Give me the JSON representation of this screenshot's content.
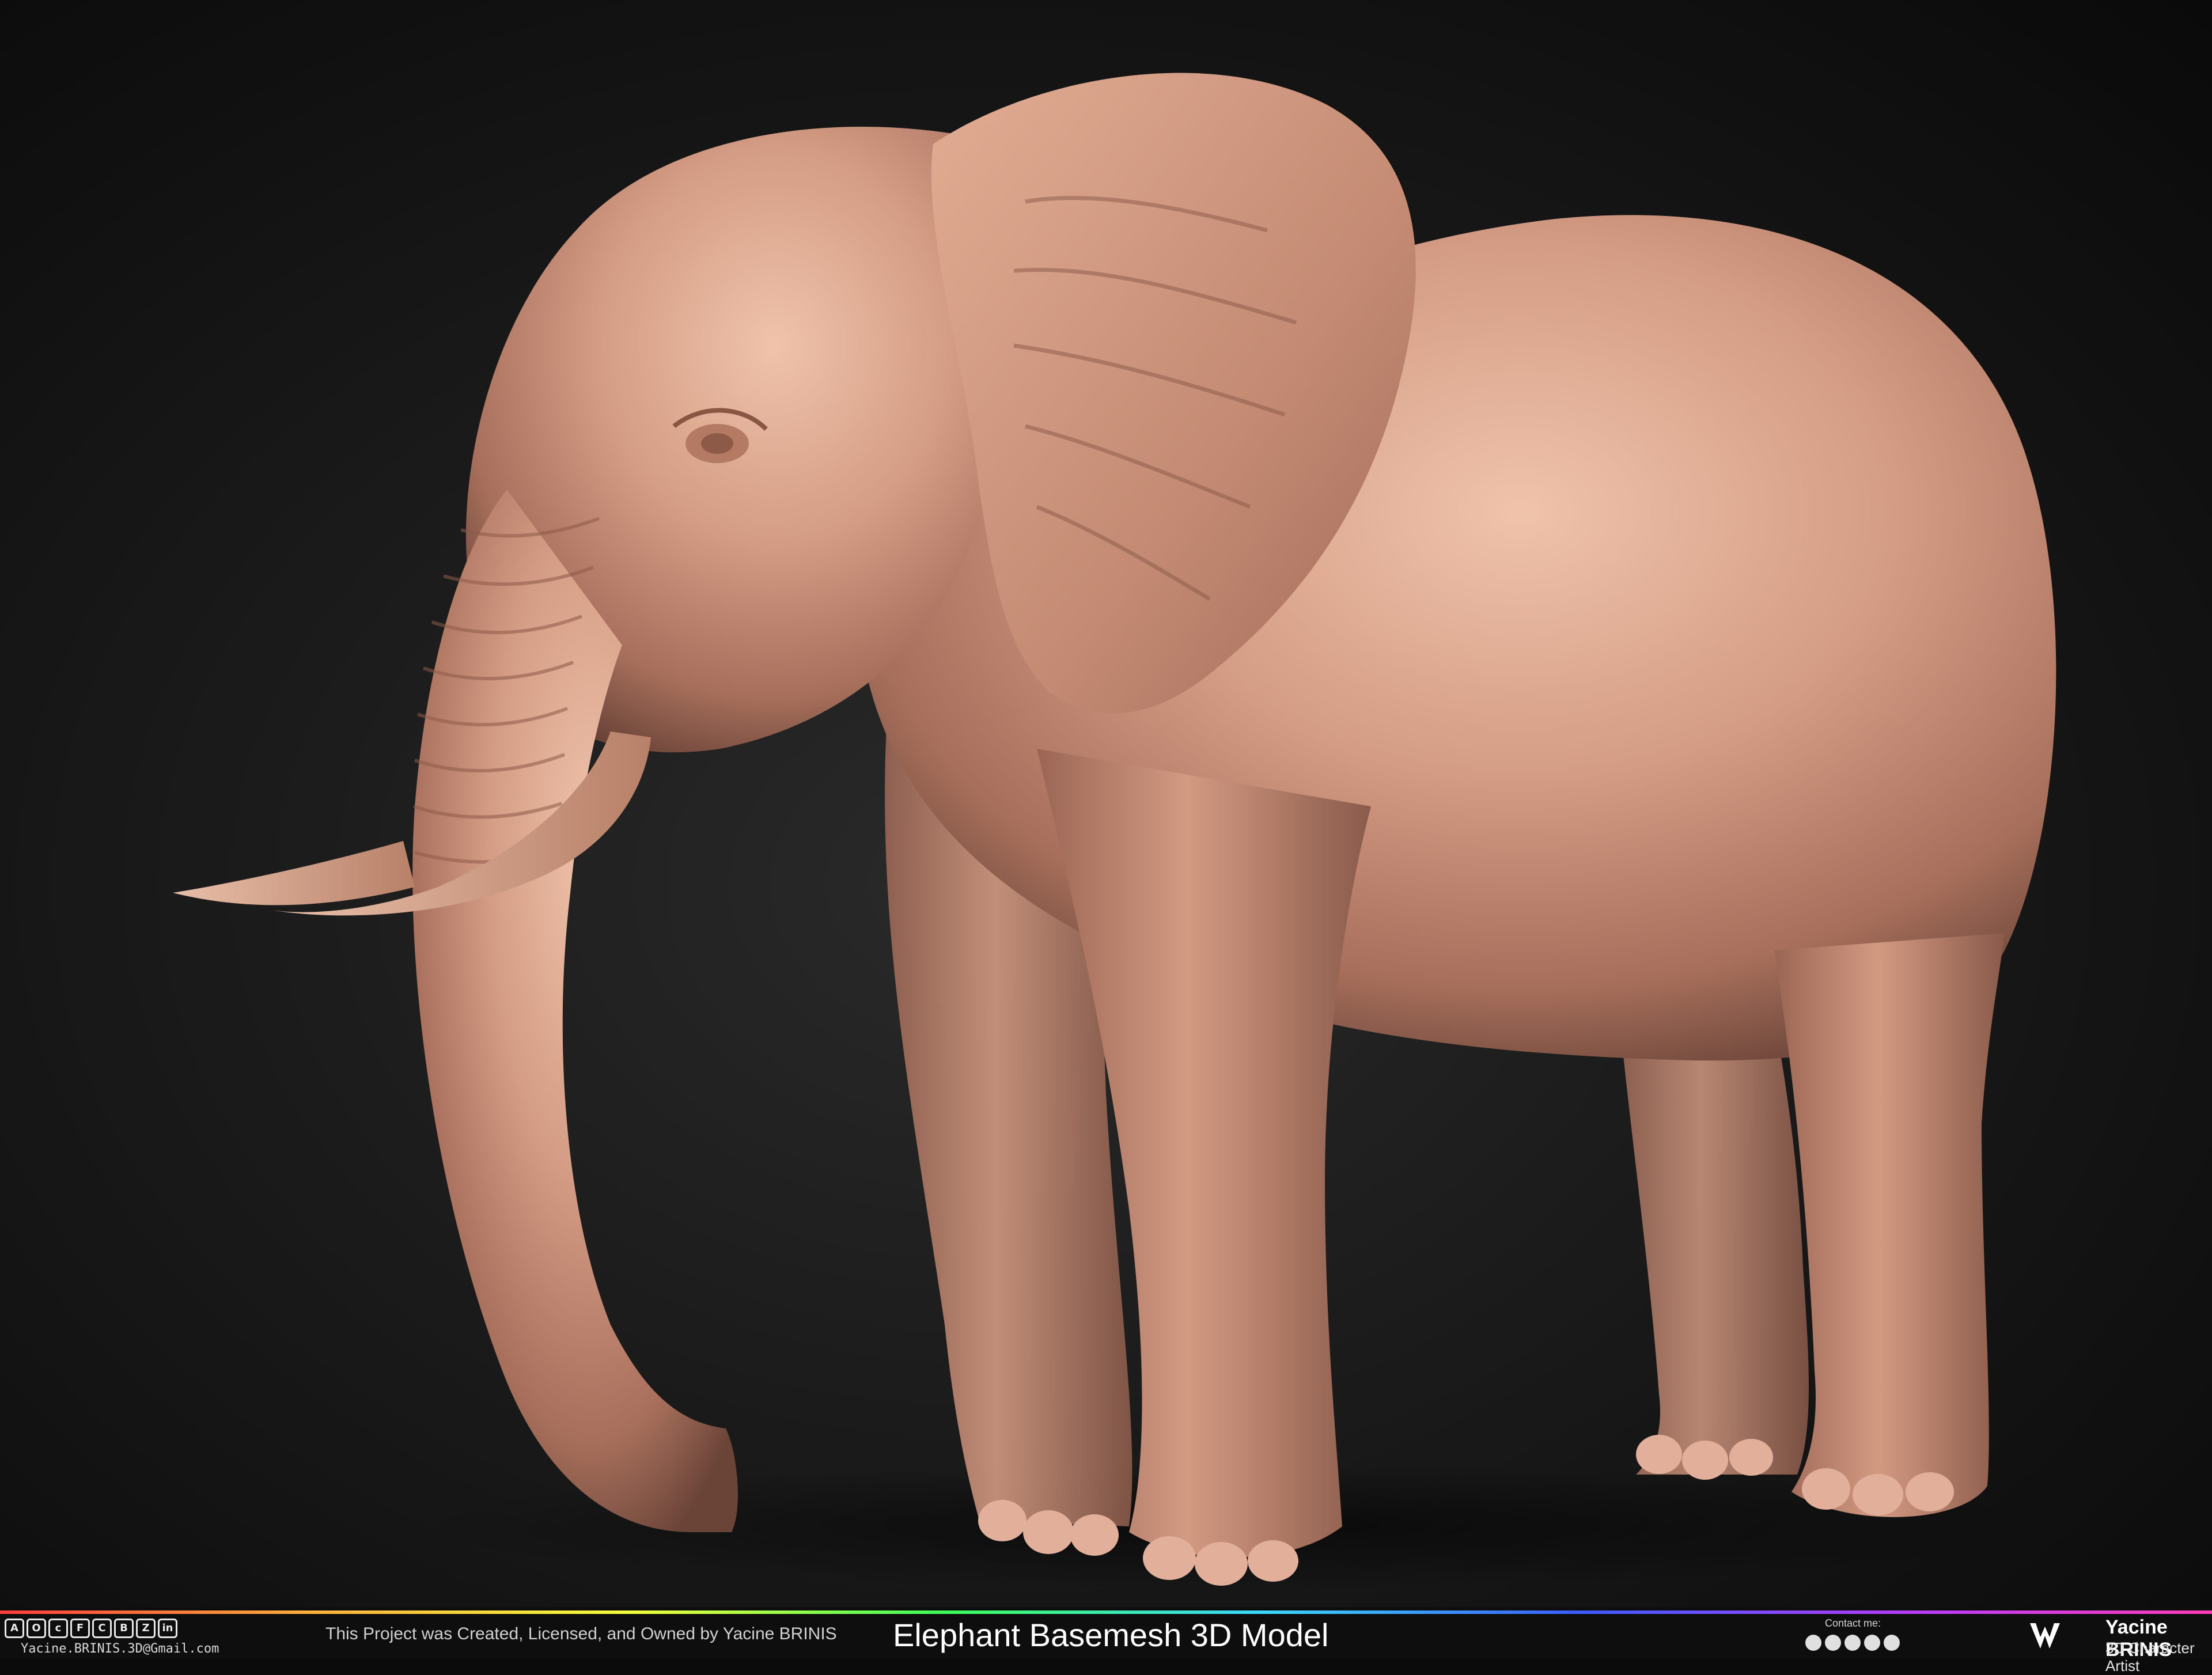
{
  "render": {
    "subject_icon": "elephant-sculpt",
    "skin_color": "#d49c84",
    "background_color": "#1a1a1a"
  },
  "footer": {
    "social_icons": [
      "artstation-icon",
      "sketchfab-icon",
      "cgtrader-icon",
      "turbosquid-icon",
      "3dexport-icon",
      "behance-icon",
      "sketchfab-alt-icon",
      "linkedin-icon"
    ],
    "email": "Yacine.BRINIS.3D@Gmail.com",
    "credit": "This Project was Created, Licensed, and Owned by Yacine BRINIS",
    "title": "Elephant Basemesh 3D Model",
    "contact_label": "Contact me:",
    "contact_icons": [
      "facebook-icon",
      "messenger-icon",
      "instagram-icon",
      "whatsapp-icon",
      "youtube-icon"
    ],
    "artist_name": "Yacine BRINIS",
    "artist_role": "3D Character Artist"
  }
}
